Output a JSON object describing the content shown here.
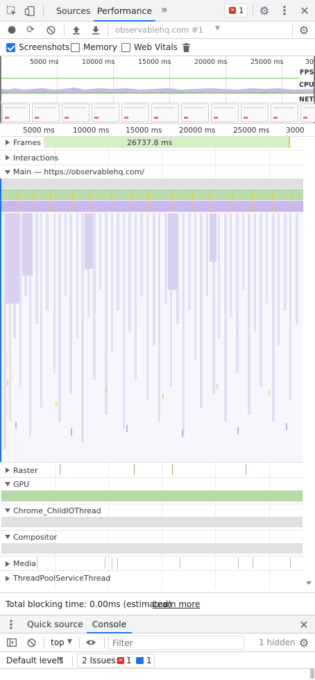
{
  "tabs": [
    {
      "label": "Sources",
      "active": false
    },
    {
      "label": "Performance",
      "active": true
    }
  ],
  "more_tabs_glyph": "»",
  "error_badge": {
    "count": "1"
  },
  "toolbar": {
    "profile_select": "observablehq.com #1"
  },
  "capture": {
    "screenshots": {
      "label": "Screenshots",
      "checked": true
    },
    "memory": {
      "label": "Memory",
      "checked": false
    },
    "web_vitals": {
      "label": "Web Vitals",
      "checked": false
    }
  },
  "overview": {
    "ticks": [
      "5000 ms",
      "10000 ms",
      "15000 ms",
      "20000 ms",
      "25000 ms",
      "30"
    ],
    "fps_label": "FPS",
    "cpu_label": "CPU",
    "net_label": "NET"
  },
  "ruler": {
    "ticks": [
      "5000 ms",
      "10000 ms",
      "15000 ms",
      "20000 ms",
      "25000 ms",
      "3000"
    ]
  },
  "tracks": {
    "frames": {
      "label": "Frames",
      "value": "26737.8 ms",
      "expanded": false
    },
    "interactions": {
      "label": "Interactions",
      "expanded": false
    },
    "main": {
      "label": "Main — https://observablehq.com/",
      "expanded": true
    },
    "raster": {
      "label": "Raster",
      "expanded": false
    },
    "gpu": {
      "label": "GPU",
      "expanded": true
    },
    "childio": {
      "label": "Chrome_ChildIOThread",
      "expanded": true
    },
    "compositor": {
      "label": "Compositor",
      "expanded": true
    },
    "media": {
      "label": "Media",
      "expanded": false
    },
    "threadpool": {
      "label": "ThreadPoolServiceThread",
      "expanded": false
    }
  },
  "summary": {
    "text": "Total blocking time: 0.00ms (estimated)",
    "link": "Learn more"
  },
  "drawer": {
    "tabs": [
      {
        "label": "Quick source",
        "active": false
      },
      {
        "label": "Console",
        "active": true
      }
    ]
  },
  "console": {
    "context": "top",
    "filter_placeholder": "Filter",
    "hidden": "1 hidden",
    "levels": "Default levels",
    "issues_label": "2 Issues:",
    "issues_error": "1",
    "issues_info": "1"
  },
  "colors": {
    "accent": "#1a73e8",
    "error": "#d93025",
    "frames_green": "#d7efc6",
    "task_green": "#b7dca6",
    "task_purple": "#c9b8f0",
    "gpu_green": "#b8d9a8"
  }
}
